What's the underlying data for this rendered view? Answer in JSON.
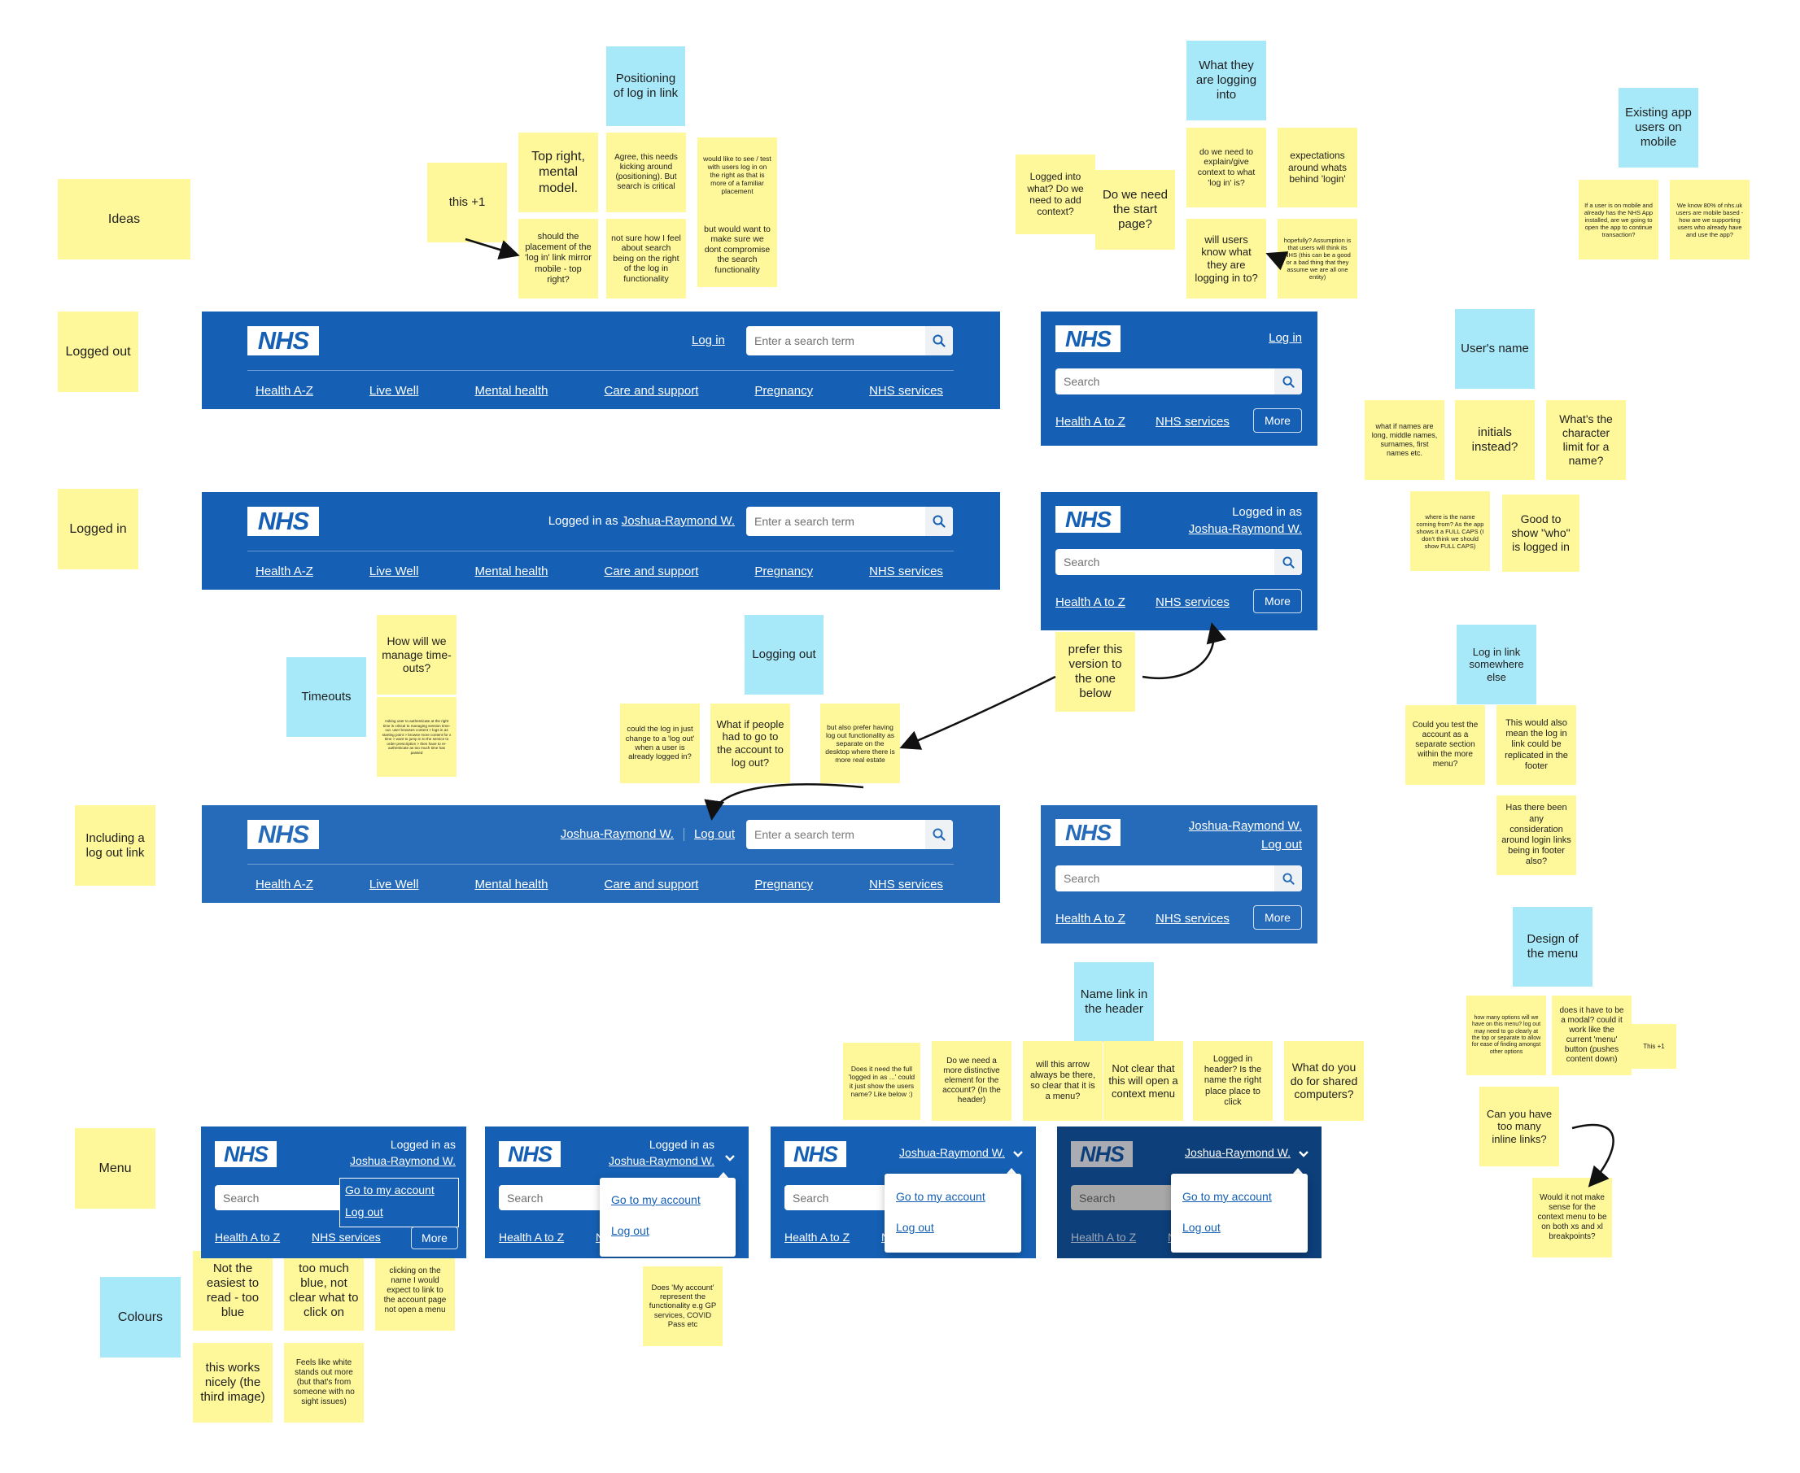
{
  "colors": {
    "nhs_blue": "#1560b4",
    "nhs_dark_blue": "#0d3f7a",
    "sticky_yellow": "#fff89a",
    "sticky_blue": "#a8e9f9"
  },
  "notes": [
    {
      "kind": "yellow",
      "text": "Ideas"
    },
    {
      "kind": "yellow",
      "text": "Logged out"
    },
    {
      "kind": "yellow",
      "text": "Logged in"
    },
    {
      "kind": "yellow",
      "text": "Including a log out link"
    },
    {
      "kind": "yellow",
      "text": "Menu"
    },
    {
      "kind": "blue",
      "text": "Colours"
    },
    {
      "kind": "blue",
      "text": "Positioning of log in link"
    },
    {
      "kind": "yellow",
      "text": "this +1"
    },
    {
      "kind": "yellow",
      "text": "Top right, mental model."
    },
    {
      "kind": "yellow",
      "text": "Agree, this needs kicking around (positioning). But search is critical"
    },
    {
      "kind": "yellow",
      "text": "would like to see / test with users log in on the right as that is more of a familiar placement"
    },
    {
      "kind": "yellow",
      "text": "but would want to make sure we dont compromise the search functionality"
    },
    {
      "kind": "yellow",
      "text": "should the placement of the 'log in' link mirror mobile - top right?"
    },
    {
      "kind": "yellow",
      "text": "not sure how I feel about search being on the right of the log in functionality"
    },
    {
      "kind": "blue",
      "text": "What they are logging into"
    },
    {
      "kind": "yellow",
      "text": "Logged into what? Do we need to add context?"
    },
    {
      "kind": "yellow",
      "text": "Do we need the start page?"
    },
    {
      "kind": "yellow",
      "text": "do we need to explain/give context to what 'log in' is?"
    },
    {
      "kind": "yellow",
      "text": "expectations around whats behind 'login'"
    },
    {
      "kind": "yellow",
      "text": "will users know what they are logging in to?"
    },
    {
      "kind": "yellow",
      "text": "hopefully? Assumption is that users will think its NHS (this can be a good or a bad thing that they assume we are all one entity)"
    },
    {
      "kind": "blue",
      "text": "Existing app users on mobile"
    },
    {
      "kind": "yellow",
      "text": "If a user is on mobile and already has the NHS App installed, are we going to open the app to continue transaction?"
    },
    {
      "kind": "yellow",
      "text": "We know 80% of nhs.uk users are mobile based - how are we supporting users who already have and use the app?"
    },
    {
      "kind": "blue",
      "text": "User's name"
    },
    {
      "kind": "yellow",
      "text": "what if names are long, middle names, surnames, first names etc."
    },
    {
      "kind": "yellow",
      "text": "initials instead?"
    },
    {
      "kind": "yellow",
      "text": "What's the character limit for a name?"
    },
    {
      "kind": "yellow",
      "text": "where is the name coming from? As the app shows it a FULL CAPS (I don't think we should show FULL CAPS)"
    },
    {
      "kind": "yellow",
      "text": "Good to show \"who\" is logged in"
    },
    {
      "kind": "blue",
      "text": "Timeouts"
    },
    {
      "kind": "yellow",
      "text": "How will we manage time-outs?"
    },
    {
      "kind": "yellow",
      "text": "Asking user to authenticate at the right time is critical to managing session time-out. user browses content > logs in as starting point > browse more content for x time > want to jump in to the service to order prescription > then have to re-authenticate as too much time has passed"
    },
    {
      "kind": "blue",
      "text": "Logging out"
    },
    {
      "kind": "yellow",
      "text": "could the log in just change to a 'log out' when a user is already logged in?"
    },
    {
      "kind": "yellow",
      "text": "What if people had to go to the account to log out?"
    },
    {
      "kind": "yellow",
      "text": "but also prefer having log out functionality as separate on the desktop where there is more real estate"
    },
    {
      "kind": "yellow",
      "text": "prefer this version to the one below"
    },
    {
      "kind": "blue",
      "text": "Log in link somewhere else"
    },
    {
      "kind": "yellow",
      "text": "Could you test the account as a separate section within the more menu?"
    },
    {
      "kind": "yellow",
      "text": "This would also mean the log in link could be replicated in the footer"
    },
    {
      "kind": "yellow",
      "text": "Has there been any consideration around login links being in footer also?"
    },
    {
      "kind": "blue",
      "text": "Name link in the header"
    },
    {
      "kind": "yellow",
      "text": "Does it need the full 'logged in as ...' could it just show the users name? Like below :)"
    },
    {
      "kind": "yellow",
      "text": "Do we need a more distinctive element for the account? (In the header)"
    },
    {
      "kind": "yellow",
      "text": "will this arrow always be there, so clear that it is a menu?"
    },
    {
      "kind": "yellow",
      "text": "Not clear that this will open a context menu"
    },
    {
      "kind": "yellow",
      "text": "Logged in header? Is the name the right place place to click"
    },
    {
      "kind": "yellow",
      "text": "What do you do for shared computers?"
    },
    {
      "kind": "blue",
      "text": "Design of the menu"
    },
    {
      "kind": "yellow",
      "text": "how many options will we have on this menu? log out may need to go clearly at the top or separate to allow for ease of finding amongst other options"
    },
    {
      "kind": "yellow",
      "text": "does it have to be a modal? could it work like the current 'menu' button (pushes content down)"
    },
    {
      "kind": "yellow",
      "text": "This +1"
    },
    {
      "kind": "yellow",
      "text": "Can you have too many inline links?"
    },
    {
      "kind": "yellow",
      "text": "Would it not make sense for the context menu to be on both xs and xl breakpoints?"
    },
    {
      "kind": "yellow",
      "text": "Not the easiest to read - too blue"
    },
    {
      "kind": "yellow",
      "text": "too much blue, not clear what to click on"
    },
    {
      "kind": "yellow",
      "text": "clicking on the name I would expect to link to the account page not open a menu"
    },
    {
      "kind": "yellow",
      "text": "this works nicely (the third image)"
    },
    {
      "kind": "yellow",
      "text": "Feels like white stands out more (but that's from someone with no sight issues)"
    },
    {
      "kind": "yellow",
      "text": "Does 'My account' represent the functionality e.g GP services, COVID Pass etc"
    }
  ],
  "header": {
    "logo": "NHS",
    "login": "Log in",
    "logged_in_as": "Logged in as",
    "user_name": "Joshua-Raymond W.",
    "logout": "Log out",
    "desktop_search_placeholder": "Enter a search term",
    "mobile_search_placeholder": "Search",
    "desktop_nav": [
      "Health A-Z",
      "Live Well",
      "Mental health",
      "Care and support",
      "Pregnancy",
      "NHS services"
    ],
    "mobile_nav": [
      "Health A to Z",
      "NHS services"
    ],
    "more": "More",
    "menu_items": [
      "Go to my account",
      "Log out"
    ],
    "search_icon": "magnifier",
    "menu_icon": "chevron-down"
  }
}
